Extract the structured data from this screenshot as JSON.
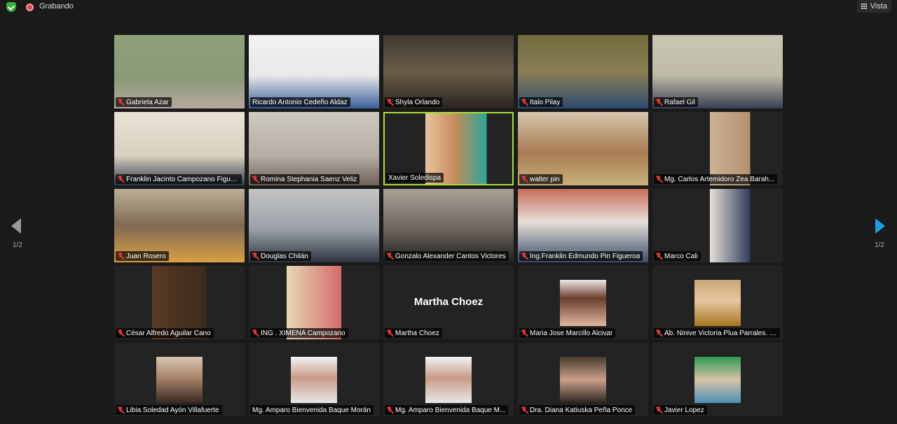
{
  "topbar": {
    "recording_label": "Grabando",
    "view_label": "Vista",
    "shield_icon": "green-shield-check-icon",
    "recording_icon": "record-dot-icon",
    "view_icon": "grid-view-icon"
  },
  "pagination": {
    "left": "1/2",
    "right": "1/2"
  },
  "colors": {
    "background": "#1a1a1a",
    "tile": "#232323",
    "active_speaker_border": "#a6e22e",
    "muted_mic": "#e03535",
    "next_arrow": "#1e9be8"
  },
  "participants": [
    {
      "name": "Gabriela Azar",
      "muted": true
    },
    {
      "name": "Ricardo Antonio Cedeño Aldaz",
      "muted": false
    },
    {
      "name": "Shyla Orlando",
      "muted": true
    },
    {
      "name": "Italo Pilay",
      "muted": true
    },
    {
      "name": "Rafael Gil",
      "muted": true
    },
    {
      "name": "Franklin Jacinto Campozano Figue...",
      "muted": true
    },
    {
      "name": "Romina Stephania Saenz Veliz",
      "muted": true
    },
    {
      "name": "Xavier Soledispa",
      "muted": false,
      "active": true
    },
    {
      "name": "walter pin",
      "muted": true
    },
    {
      "name": "Mg. Carlos Artemidoro Zea Barah...",
      "muted": true
    },
    {
      "name": "Juan Rosero",
      "muted": true
    },
    {
      "name": "Douglas Chilán",
      "muted": true
    },
    {
      "name": "Gonzalo Alexander Cantos Victores",
      "muted": true
    },
    {
      "name": "Ing.Franklin Edmundo Pin Figueroa",
      "muted": true
    },
    {
      "name": "Marco Cali",
      "muted": true
    },
    {
      "name": "César Alfredo Aguilar Cano",
      "muted": true
    },
    {
      "name": "ING . XIMENA Campozano",
      "muted": true
    },
    {
      "name": "Martha Choez",
      "muted": true,
      "video_off": true
    },
    {
      "name": "Maria Jose Marcillo Alcivar",
      "muted": true
    },
    {
      "name": "Ab. Ninive Victoria Plua Parrales. E...",
      "muted": true
    },
    {
      "name": "Libia Soledad Ayón Villafuerte",
      "muted": true
    },
    {
      "name": "Mg. Amparo Bienvenida Baque Morán",
      "muted": false
    },
    {
      "name": "Mg. Amparo Bienvenida Baque M...",
      "muted": true
    },
    {
      "name": "Dra. Diana Katiuska Peña Ponce",
      "muted": true
    },
    {
      "name": "Javier Lopez",
      "muted": true
    }
  ]
}
